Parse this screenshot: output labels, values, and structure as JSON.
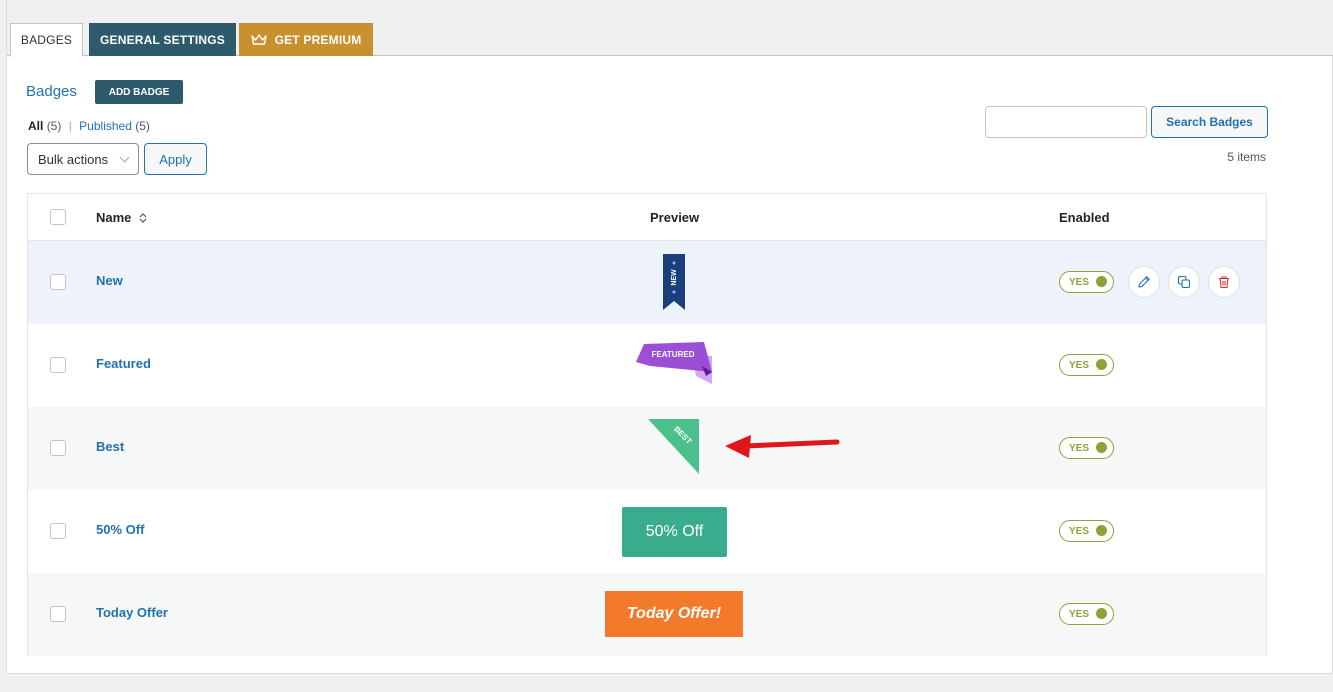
{
  "tabs": {
    "badges": "BADGES",
    "general": "GENERAL SETTINGS",
    "premium": "GET PREMIUM"
  },
  "header": {
    "title": "Badges",
    "add_button": "ADD BADGE"
  },
  "filters": {
    "all_label": "All",
    "all_count": "(5)",
    "separator": "|",
    "published_label": "Published",
    "published_count": "(5)"
  },
  "bulk": {
    "label": "Bulk actions",
    "apply": "Apply"
  },
  "search": {
    "button": "Search Badges",
    "placeholder": ""
  },
  "items_count": "5 items",
  "table": {
    "columns": [
      "Name",
      "Preview",
      "Enabled"
    ],
    "rows": [
      {
        "name": "New",
        "badge_text": "NEW",
        "enabled": "YES"
      },
      {
        "name": "Featured",
        "badge_text": "FEATURED",
        "enabled": "YES"
      },
      {
        "name": "Best",
        "badge_text": "BEST",
        "enabled": "YES"
      },
      {
        "name": "50% Off",
        "badge_text": "50% Off",
        "enabled": "YES"
      },
      {
        "name": "Today Offer",
        "badge_text": "Today Offer!",
        "enabled": "YES"
      }
    ]
  },
  "icons": {
    "sort": "sort-icon",
    "crown": "crown-icon",
    "edit": "pencil-icon",
    "duplicate": "duplicate-icon",
    "delete": "trash-icon",
    "annotation": "red-arrow-icon"
  },
  "colors": {
    "accent": "#2271b1",
    "tab_dark": "#2e5a6e",
    "premium": "#c8902f",
    "toggle": "#8da337",
    "badge_new": "#1b3f7a",
    "badge_featured": "#9b4fd6",
    "badge_best": "#4cc08c",
    "badge_50off": "#3bab8e",
    "badge_today": "#f47a2b",
    "arrow": "#e0161d"
  }
}
